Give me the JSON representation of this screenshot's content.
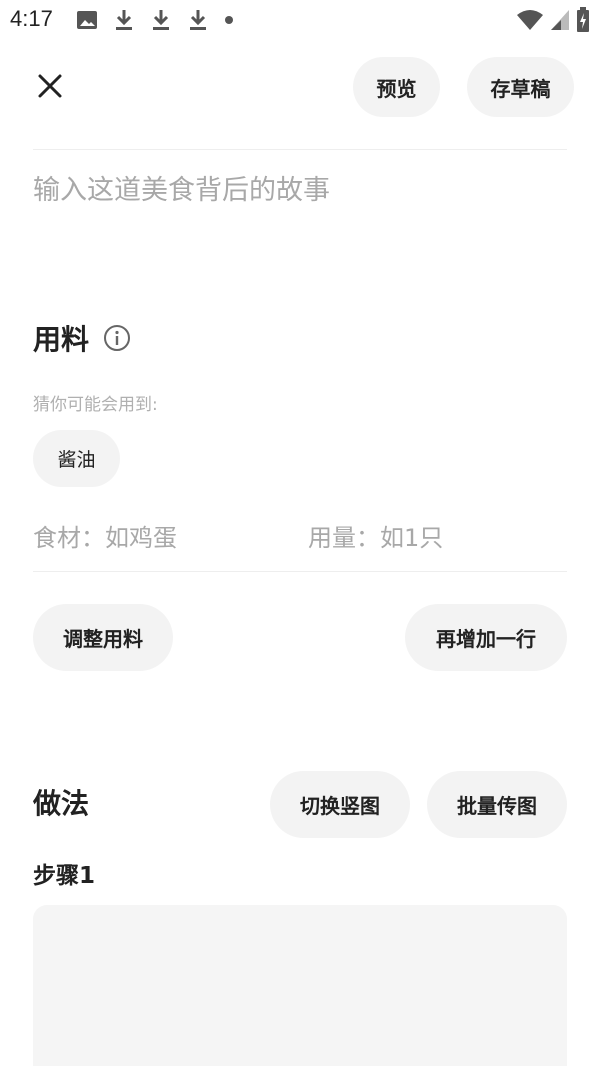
{
  "status_bar": {
    "time": "4:17",
    "left_icons": [
      "image-icon",
      "download-icon",
      "download-icon",
      "download-icon",
      "dot-icon"
    ],
    "right_icons": [
      "wifi-icon",
      "signal-icon",
      "battery-charging-icon"
    ]
  },
  "top_bar": {
    "close_icon": "close-icon",
    "preview_label": "预览",
    "draft_label": "存草稿"
  },
  "story": {
    "placeholder": "输入这道美食背后的故事"
  },
  "ingredients": {
    "title": "用料",
    "info_icon": "info-icon",
    "hint": "猜你可能会用到:",
    "suggestions": [
      "酱油"
    ],
    "food_placeholder": "食材：如鸡蛋",
    "amount_placeholder": "用量：如1只",
    "adjust_label": "调整用料",
    "add_row_label": "再增加一行"
  },
  "method": {
    "title": "做法",
    "switch_label": "切换竖图",
    "batch_label": "批量传图",
    "step_label": "步骤1"
  },
  "colors": {
    "pill_bg": "#f3f3f3",
    "placeholder": "#a8a8a8",
    "hint": "#b0b0b0",
    "text": "#222222"
  }
}
